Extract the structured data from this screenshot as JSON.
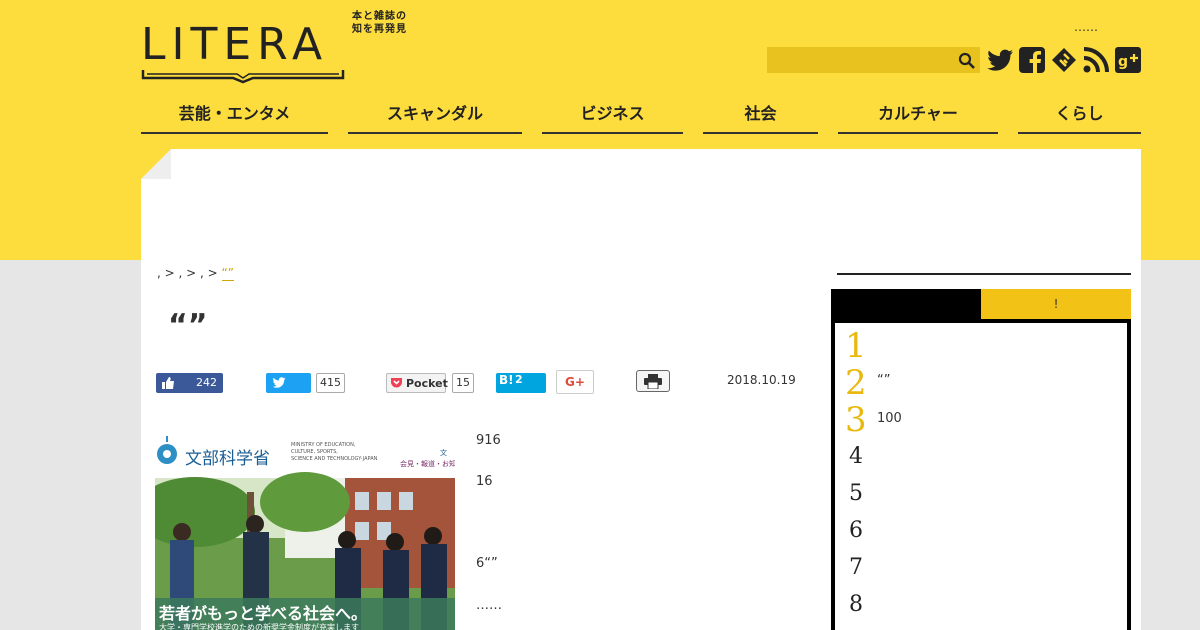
{
  "header": {
    "logo": "LITERA",
    "tagline_line1": "本と雑誌の",
    "tagline_line2": "知を再発見",
    "top_link": "……",
    "search_placeholder": ""
  },
  "nav": [
    {
      "label": "芸能・エンタメ"
    },
    {
      "label": "スキャンダル"
    },
    {
      "label": "ビジネス"
    },
    {
      "label": "社会"
    },
    {
      "label": "カルチャー"
    },
    {
      "label": "くらし"
    }
  ],
  "breadcrumb": {
    "sep1": ", > ",
    "sep2": ", > ",
    "sep3": ", > ",
    "current": "“”"
  },
  "article": {
    "title": "“”",
    "date": "2018.10.19",
    "paragraphs": [
      "916",
      "16",
      "6“”",
      "……"
    ]
  },
  "share": {
    "facebook_count": "242",
    "twitter_count": "415",
    "pocket_label": "Pocket",
    "pocket_count": "15",
    "hatena_label": "B!",
    "hatena_count": "2",
    "gplus_label": "G+"
  },
  "image": {
    "org_name": "文部科学省",
    "org_en_line1": "MINISTRY OF EDUCATION,",
    "org_en_line2": "CULTURE, SPORTS,",
    "org_en_line3": "SCIENCE AND TECHNOLOGY-JAPAN",
    "top_right_line1": "文",
    "top_right_line2": "会見・報道・お知",
    "caption": "若者がもっと学べる社会へ。",
    "subcaption": "大学・専門学校進学のための新奨学金制度が充実します"
  },
  "sidebar": {
    "tab_active": "",
    "tab_other": "!",
    "ranking": [
      {
        "num": "1",
        "text": ""
      },
      {
        "num": "2",
        "text": "“”"
      },
      {
        "num": "3",
        "text": "100"
      },
      {
        "num": "4",
        "text": ""
      },
      {
        "num": "5",
        "text": ""
      },
      {
        "num": "6",
        "text": ""
      },
      {
        "num": "7",
        "text": ""
      },
      {
        "num": "8",
        "text": ""
      }
    ]
  },
  "colors": {
    "brand_yellow": "#fddc3e",
    "rank_gold": "#e8b90f",
    "facebook": "#3b5998",
    "twitter": "#1da1f2",
    "hatena": "#00a4de",
    "pocket": "#ee4056"
  },
  "icons": [
    "search-icon",
    "twitter-icon",
    "facebook-icon",
    "feedly-icon",
    "rss-icon",
    "google-plus-icon",
    "print-icon",
    "like-icon"
  ]
}
